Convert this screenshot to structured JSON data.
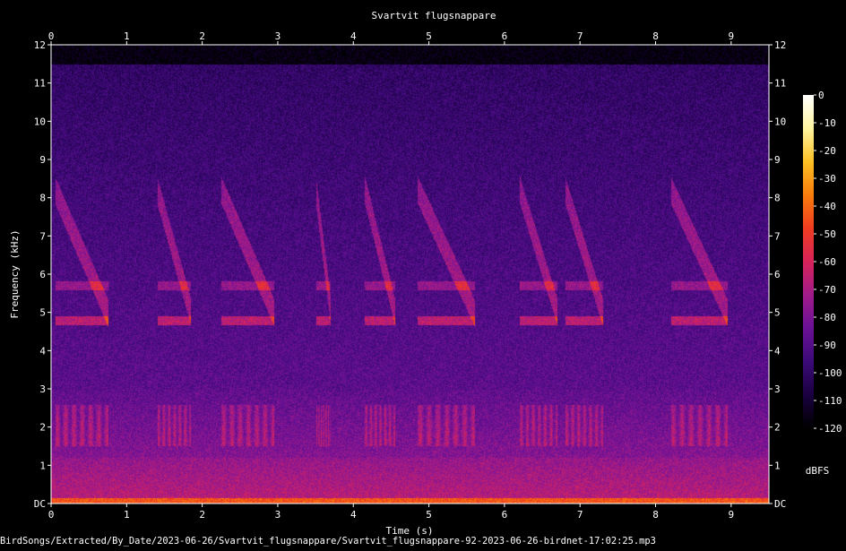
{
  "chart_data": {
    "type": "heatmap",
    "title": "Svartvit flugsnappare",
    "xlabel": "Time (s)",
    "ylabel": "Frequency (kHz)",
    "x_ticks": [
      "0",
      "1",
      "2",
      "3",
      "4",
      "5",
      "6",
      "7",
      "8",
      "9"
    ],
    "x_range": [
      0,
      9.5
    ],
    "y_ticks": [
      "DC",
      "1",
      "2",
      "3",
      "4",
      "5",
      "6",
      "7",
      "8",
      "9",
      "10",
      "11",
      "12"
    ],
    "y_range": [
      0,
      12
    ],
    "colorbar": {
      "label": "dBFS",
      "ticks": [
        "0",
        "-10",
        "-20",
        "-30",
        "-40",
        "-50",
        "-60",
        "-70",
        "-80",
        "-90",
        "-100",
        "-110",
        "-120"
      ],
      "range": [
        -120,
        0
      ]
    },
    "colormap": [
      "#000000",
      "#1a0040",
      "#3c0a78",
      "#6a1196",
      "#a01b8a",
      "#d8235a",
      "#f03c20",
      "#f87c0c",
      "#fcc024",
      "#fff4a0",
      "#ffffff"
    ],
    "noise_floor_khz": 11.5,
    "song_strophes": [
      {
        "start_s": 0.05,
        "end_s": 0.75
      },
      {
        "start_s": 1.4,
        "end_s": 1.85
      },
      {
        "start_s": 2.25,
        "end_s": 2.95
      },
      {
        "start_s": 3.5,
        "end_s": 3.7
      },
      {
        "start_s": 4.15,
        "end_s": 4.55
      },
      {
        "start_s": 4.85,
        "end_s": 5.6
      },
      {
        "start_s": 6.2,
        "end_s": 6.7
      },
      {
        "start_s": 6.8,
        "end_s": 7.3
      },
      {
        "start_s": 8.2,
        "end_s": 8.95
      }
    ]
  },
  "footer": {
    "path": "BirdSongs/Extracted/By_Date/2023-06-26/Svartvit_flugsnappare/Svartvit_flugsnappare-92-2023-06-26-birdnet-17:02:25.mp3"
  }
}
